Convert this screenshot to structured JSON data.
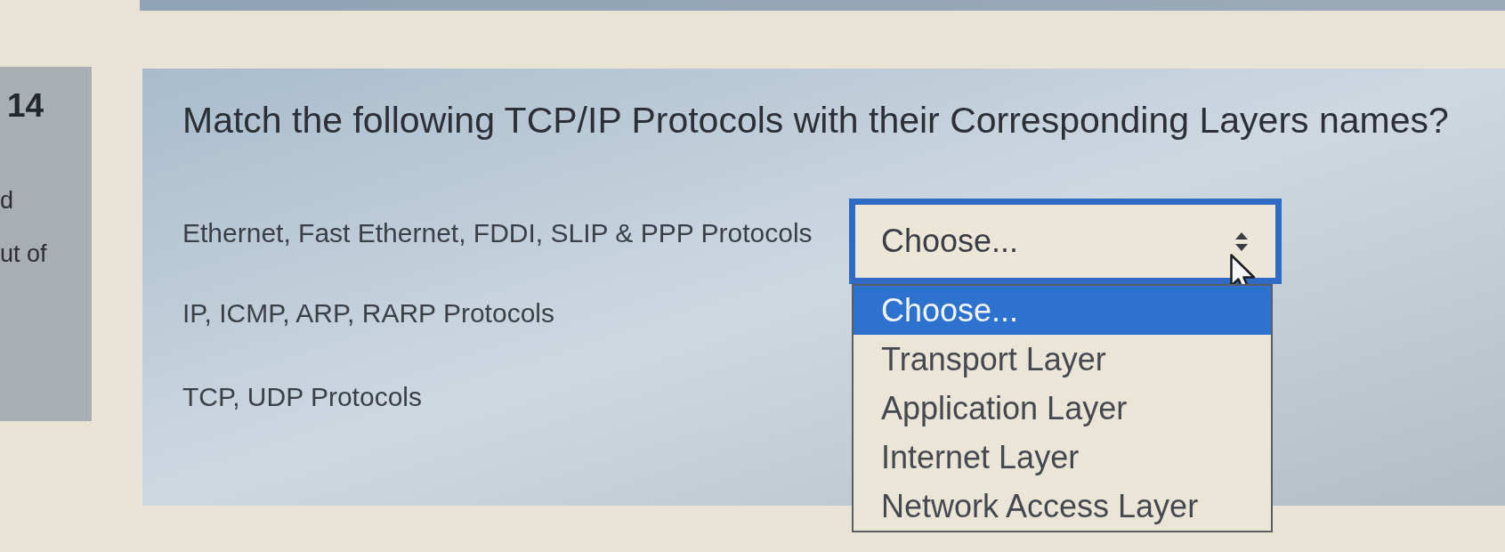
{
  "info": {
    "number": "14",
    "fragments": [
      "d",
      "ut of"
    ]
  },
  "question": "Match the following TCP/IP Protocols with their Corresponding Layers names?",
  "rows": [
    {
      "prompt": "Ethernet, Fast Ethernet, FDDI, SLIP & PPP Protocols",
      "select": {
        "value": "Choose...",
        "expanded": true,
        "options": [
          {
            "label": "Choose...",
            "selected": true
          },
          {
            "label": "Transport Layer",
            "selected": false
          },
          {
            "label": "Application Layer",
            "selected": false
          },
          {
            "label": "Internet Layer",
            "selected": false
          },
          {
            "label": "Network Access Layer",
            "selected": false
          }
        ]
      }
    },
    {
      "prompt": "IP, ICMP, ARP, RARP Protocols"
    },
    {
      "prompt": "TCP, UDP Protocols"
    }
  ]
}
